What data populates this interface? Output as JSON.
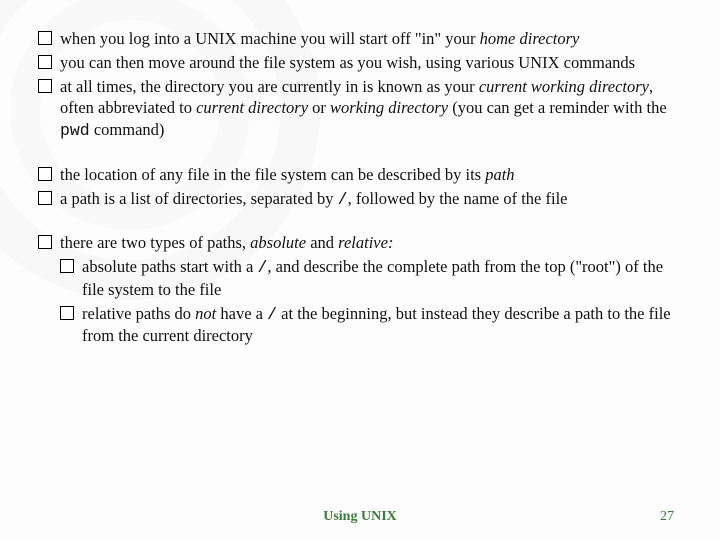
{
  "blocks": [
    {
      "items": [
        {
          "html": "when you log into a UNIX machine you will start off \"in\" your <span class=\"it\">home directory</span>"
        },
        {
          "html": "you can then move around the file system as you wish, using various UNIX commands"
        },
        {
          "html": "at all times, the directory you are currently in is known as your <span class=\"it\">current working directory</span>, often abbreviated to <span class=\"it\">current directory</span> or <span class=\"it\">working directory</span> (you can get a reminder with the <span class=\"mono\">pwd</span> command)"
        }
      ]
    },
    {
      "items": [
        {
          "html": "the location of any file in the file system can be described by its <span class=\"it\">path</span>"
        },
        {
          "html": "a path is a list of directories, separated by <span class=\"mono\">/</span>, followed by the name of the file"
        }
      ]
    },
    {
      "items": [
        {
          "html": "there are two types of paths, <span class=\"it\">absolute</span> and <span class=\"it\">relative:</span>",
          "children": [
            {
              "html": "absolute paths start with a <span class=\"mono\">/</span>, and describe the complete path from the top (\"root\") of the file system to the file"
            },
            {
              "html": "relative paths do <span class=\"it\">not</span> have a <span class=\"mono\">/</span> at the beginning, but instead they describe a path to the file from the current directory"
            }
          ]
        }
      ]
    }
  ],
  "footer": {
    "title": "Using UNIX",
    "page": "27"
  }
}
